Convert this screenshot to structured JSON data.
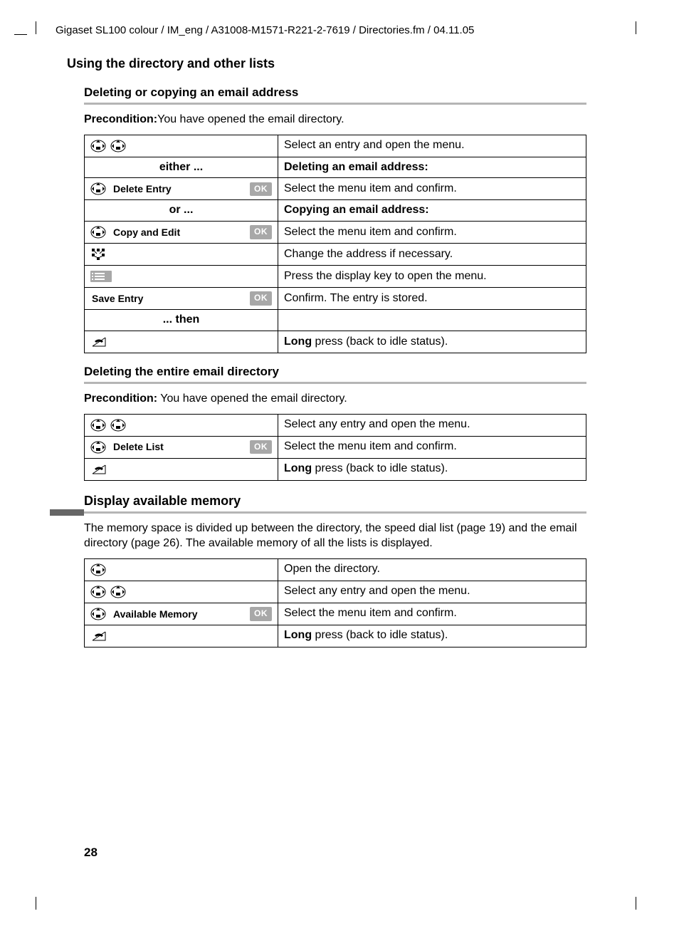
{
  "header": "Gigaset SL100 colour / IM_eng / A31008-M1571-R221-2-7619 / Directories.fm / 04.11.05",
  "h1": "Using the directory and other lists",
  "section1": {
    "title": "Deleting or copying an email address",
    "precond_label": "Precondition:",
    "precond_text": "You have opened the email directory.",
    "rows": [
      {
        "left_type": "icons2",
        "right": "Select an entry and open the menu."
      },
      {
        "left_type": "center_bold",
        "left_text": "either ...",
        "right_bold": "Deleting an email address:"
      },
      {
        "left_type": "menu_ok",
        "menu": "Delete Entry",
        "right": "Select the menu item and confirm."
      },
      {
        "left_type": "center_bold",
        "left_text": "or ...",
        "right_bold": "Copying an email address:"
      },
      {
        "left_type": "menu_ok",
        "menu": "Copy and Edit",
        "right": "Select the menu item and confirm."
      },
      {
        "left_type": "keypad",
        "right": "Change the address if necessary."
      },
      {
        "left_type": "menu_key",
        "right": "Press the display key to open the menu."
      },
      {
        "left_type": "menu_ok_noicon",
        "menu": "Save Entry",
        "right": "Confirm. The entry is stored."
      },
      {
        "left_type": "center_bold",
        "left_text": "... then",
        "right": ""
      },
      {
        "left_type": "hangup",
        "right_long": "Long",
        "right_rest": " press (back to idle status)."
      }
    ]
  },
  "section2": {
    "title": "Deleting the entire email directory",
    "precond_label": "Precondition:",
    "precond_text": " You have opened the email directory.",
    "rows": [
      {
        "left_type": "icons2",
        "right": "Select any entry and open the menu."
      },
      {
        "left_type": "menu_ok",
        "menu": "Delete List",
        "right": "Select the menu item and confirm."
      },
      {
        "left_type": "hangup",
        "right_long": "Long",
        "right_rest": " press (back to idle status)."
      }
    ]
  },
  "section3": {
    "title": "Display available memory",
    "para": "The memory space is divided up between the directory, the speed dial list (page 19) and the email directory (page 26). The available memory of all the lists is displayed.",
    "rows": [
      {
        "left_type": "icon1",
        "right": "Open the directory."
      },
      {
        "left_type": "icons2",
        "right": "Select any entry and open the menu."
      },
      {
        "left_type": "menu_ok",
        "menu": "Available Memory",
        "right": "Select the menu item and confirm."
      },
      {
        "left_type": "hangup",
        "right_long": "Long",
        "right_rest": " press (back to idle status)."
      }
    ]
  },
  "ok_label": "OK",
  "page_number": "28"
}
